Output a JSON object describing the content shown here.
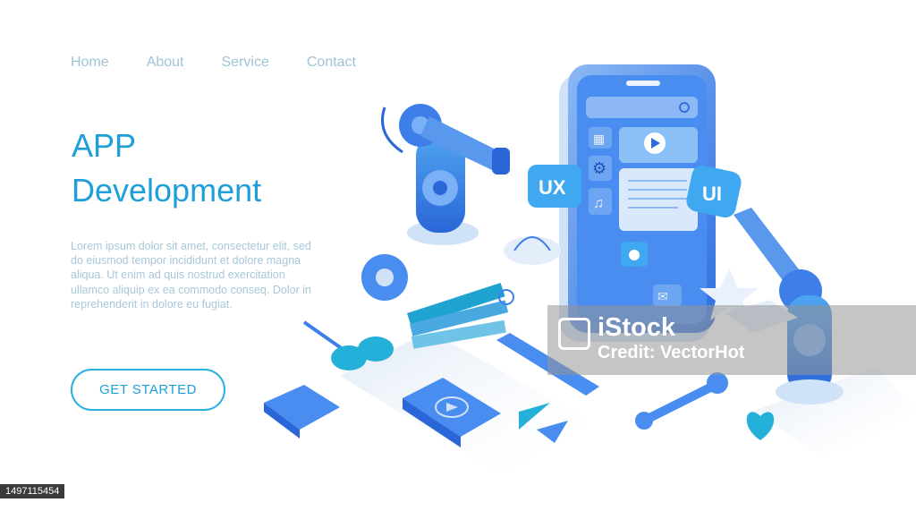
{
  "nav": {
    "items": [
      {
        "label": "Home"
      },
      {
        "label": "About"
      },
      {
        "label": "Service"
      },
      {
        "label": "Contact"
      }
    ]
  },
  "hero": {
    "title_line1": "APP",
    "title_line2": "Development",
    "body": "Lorem ipsum dolor sit amet, consectetur elit, sed do eiusmod tempor incididunt et dolore magna aliqua. Ut enim ad quis nostrud exercitation ullamco aliquip ex ea commodo conseq. Dolor in reprehenderit in dolore eu fugiat.",
    "cta_label": "GET STARTED"
  },
  "illustration": {
    "ux_label": "UX",
    "ui_label": "UI",
    "icons": [
      "calendar-icon",
      "gear-icon",
      "music-icon",
      "play-icon",
      "camera-icon",
      "mail-icon",
      "search-icon",
      "star-icon",
      "heart-icon",
      "wrench-icon",
      "ruler-icon",
      "scissors-icon",
      "image-icon",
      "color-swatches-icon",
      "bezier-curve-icon",
      "robot-arm-icon"
    ]
  },
  "watermark": {
    "line1": "iStock",
    "line2": "Credit: VectorHot",
    "image_id": "1497115454"
  },
  "colors": {
    "accent": "#1f9fd9",
    "nav": "#9fc3d6",
    "body": "#a8c8d8",
    "blue": "#3d7ee8",
    "light": "#cfe2f7"
  }
}
